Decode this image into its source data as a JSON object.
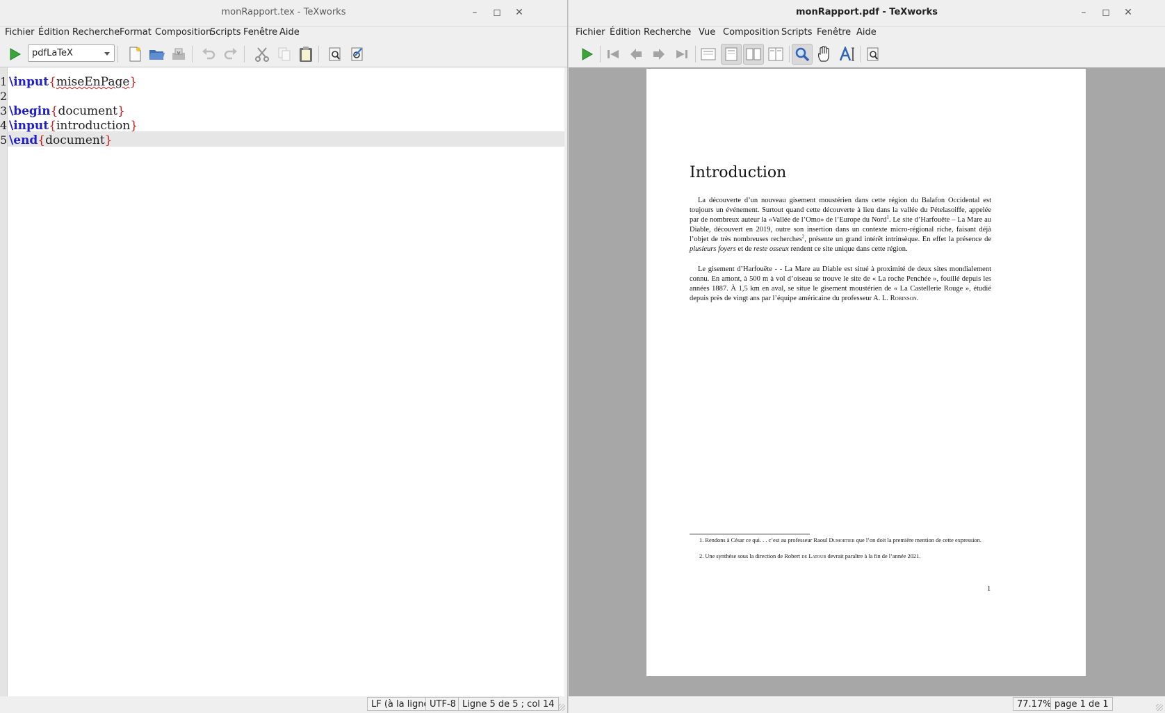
{
  "left_window": {
    "title": "monRapport.tex - TeXworks",
    "menu": [
      "Fichier",
      "Édition",
      "Recherche",
      "Format",
      "Composition",
      "Scripts",
      "Fenêtre",
      "Aide"
    ],
    "engine": "pdfLaTeX",
    "toolbar_icons": [
      "typeset-icon",
      "new-file-icon",
      "open-folder-icon",
      "save-icon",
      "undo-icon",
      "redo-icon",
      "cut-icon",
      "copy-icon",
      "paste-icon",
      "find-icon",
      "replace-icon"
    ],
    "editor": {
      "current_line": 5,
      "lines": [
        {
          "num": "1",
          "cmd": "\\input",
          "open": "{",
          "arg": "miseEnPage",
          "close": "}"
        },
        {
          "num": "2",
          "cmd": "",
          "open": "",
          "arg": "",
          "close": ""
        },
        {
          "num": "3",
          "cmd": "\\begin",
          "open": "{",
          "arg": "document",
          "close": "}"
        },
        {
          "num": "4",
          "cmd": "\\input",
          "open": "{",
          "arg": "introduction",
          "close": "}"
        },
        {
          "num": "5",
          "cmd": "\\end",
          "open": "{",
          "arg": "document",
          "close": "}"
        }
      ]
    },
    "status": {
      "line_ending": "LF (à la ligne)",
      "encoding": "UTF-8",
      "position": "Ligne 5 de 5 ; col 14"
    }
  },
  "right_window": {
    "title": "monRapport.pdf - TeXworks",
    "menu": [
      "Fichier",
      "Édition",
      "Recherche",
      "Vue",
      "Composition",
      "Scripts",
      "Fenêtre",
      "Aide"
    ],
    "toolbar_icons": [
      "typeset-icon",
      "first-page-icon",
      "previous-page-icon",
      "next-page-icon",
      "last-page-icon",
      "single-page-icon",
      "continuous-page-icon",
      "two-pages-icon",
      "continuous-two-pages-icon",
      "magnify-tool-icon",
      "hand-tool-icon",
      "text-select-tool-icon",
      "find-icon"
    ],
    "pdf": {
      "heading": "Introduction",
      "p1_a": "La découverte d’un nouveau gisement moustérien dans cette région du Balafon Occidental est toujours un événement. Surtout quand cette découverte à lieu dans la vallée du Pételasoiffe, appelée par de nombreux auteur la «Vallée de l’Omo» de l’Europe du Nord",
      "p1_sup1": "1",
      "p1_b": ". Le site d’Harfouëte – La Mare au Diable, découvert en 2019, outre son insertion dans un contexte micro-régional riche, faisant déjà l’objet de très nombreuses recherches",
      "p1_sup2": "2",
      "p1_c": ", présente un grand intérêt intrinsèque. En effet la présence de",
      "p1_em1": "plusieurs foyers",
      "p1_d": "et de",
      "p1_em2": "reste osseux",
      "p1_e": "rendent ce site unique dans cette région.",
      "p2_a": "Le gisement d’Harfouëte - - La Mare au Diable est situé à proximité de deux sites mondialement connu. En amont, à 500 m à vol d’oiseau se trouve le site de «  La roche Penchée », fouillé depuis les années 1887. À 1,5 km en aval, se situe le gisement moustérien de « La Castellerie Rouge », étudié depuis près de vingt ans par l’équipe américaine du professeur A. L.",
      "p2_sc": "Robinson",
      "p2_end": ".",
      "fn1_a": "1. Rendons à César ce qui. . . c’est au professeur Raoul",
      "fn1_sc": "Dumortier",
      "fn1_b": "que l’on doit la première mention de cette expression.",
      "fn2_a": "2. Une synthèse sous la direction de Robert",
      "fn2_sc": "de Latour",
      "fn2_b": "devrait paraître à la fin de l’année 2021.",
      "page_number": "1"
    },
    "status": {
      "zoom": "77.17%",
      "page": "page 1 de 1"
    }
  },
  "colors": {
    "accent_green": "#3aa63a",
    "keyword_blue": "#1f1fcc",
    "brace_red": "#c81e1e"
  }
}
